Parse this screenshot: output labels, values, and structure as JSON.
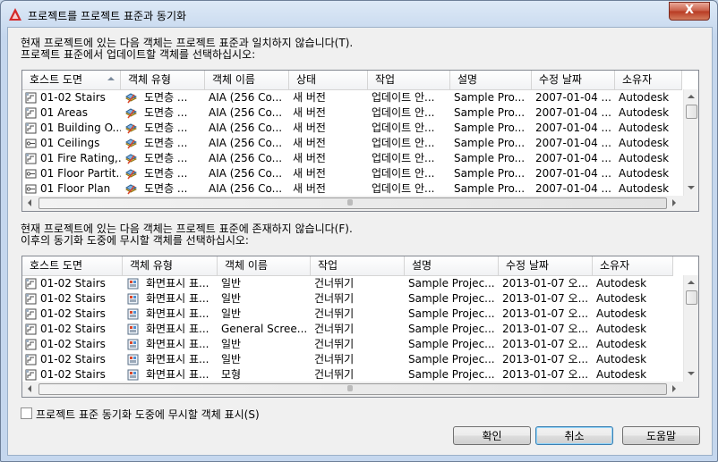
{
  "window": {
    "title": "프로젝트를 프로젝트 표준과 동기화",
    "close_glyph": "X"
  },
  "section1": {
    "prompt_line1": "현재 프로젝트에 있는 다음 객체는 프로젝트 표준과 일치하지 않습니다(T).",
    "prompt_line2": "프로젝트 표준에서 업데이트할 객체를 선택하십시오:",
    "columns": [
      "호스트 도면",
      "객체 유형",
      "객체 이름",
      "상태",
      "작업",
      "설명",
      "수정 날짜",
      "소유자"
    ],
    "rows": [
      [
        "01-02 Stairs",
        "도면층 ...",
        "AIA (256 Co...",
        "새 버전",
        "업데이트 안...",
        "Sample Pro...",
        "2007-01-04 ...",
        "Autodesk"
      ],
      [
        "01 Areas",
        "도면층 ...",
        "AIA (256 Co...",
        "새 버전",
        "업데이트 안...",
        "Sample Pro...",
        "2007-01-04 ...",
        "Autodesk"
      ],
      [
        "01 Building O...",
        "도면층 ...",
        "AIA (256 Co...",
        "새 버전",
        "업데이트 안...",
        "Sample Pro...",
        "2007-01-04 ...",
        "Autodesk"
      ],
      [
        "01 Ceilings",
        "도면층 ...",
        "AIA (256 Co...",
        "새 버전",
        "업데이트 안...",
        "Sample Pro...",
        "2007-01-04 ...",
        "Autodesk"
      ],
      [
        "01 Fire Rating,...",
        "도면층 ...",
        "AIA (256 Co...",
        "새 버전",
        "업데이트 안...",
        "Sample Pro...",
        "2007-01-04 ...",
        "Autodesk"
      ],
      [
        "01 Floor Partit...",
        "도면층 ...",
        "AIA (256 Co...",
        "새 버전",
        "업데이트 안...",
        "Sample Pro...",
        "2007-01-04 ...",
        "Autodesk"
      ],
      [
        "01 Floor Plan",
        "도면층 ...",
        "AIA (256 Co...",
        "새 버전",
        "업데이트 안...",
        "Sample Pro...",
        "2007-01-04 ...",
        "Autodesk"
      ]
    ],
    "row_icons": [
      "stair-drawing",
      "stair-drawing",
      "stair-drawing",
      "plan-drawing",
      "stair-drawing",
      "plan-drawing",
      "plan-drawing"
    ]
  },
  "section2": {
    "prompt_line1": "현재 프로젝트에 있는 다음 객체는 프로젝트 표준에 존재하지 않습니다(F).",
    "prompt_line2": "이후의 동기화 도중에 무시할 객체를 선택하십시오:",
    "columns": [
      "호스트 도면",
      "객체 유형",
      "객체 이름",
      "작업",
      "설명",
      "수정 날짜",
      "소유자"
    ],
    "rows": [
      [
        "01-02 Stairs",
        "화면표시 표...",
        "일반",
        "건너뛰기",
        "Sample Projec...",
        "2013-01-07 오...",
        "Autodesk"
      ],
      [
        "01-02 Stairs",
        "화면표시 표...",
        "일반",
        "건너뛰기",
        "Sample Projec...",
        "2013-01-07 오...",
        "Autodesk"
      ],
      [
        "01-02 Stairs",
        "화면표시 표...",
        "일반",
        "건너뛰기",
        "Sample Projec...",
        "2013-01-07 오...",
        "Autodesk"
      ],
      [
        "01-02 Stairs",
        "화면표시 표...",
        "General Scree...",
        "건너뛰기",
        "Sample Projec...",
        "2013-01-07 오...",
        "Autodesk"
      ],
      [
        "01-02 Stairs",
        "화면표시 표...",
        "일반",
        "건너뛰기",
        "Sample Projec...",
        "2013-01-07 오...",
        "Autodesk"
      ],
      [
        "01-02 Stairs",
        "화면표시 표...",
        "일반",
        "건너뛰기",
        "Sample Projec...",
        "2013-01-07 오...",
        "Autodesk"
      ],
      [
        "01-02 Stairs",
        "화면표시 표...",
        "모형",
        "건너뛰기",
        "Sample Projec...",
        "2013-01-07 오...",
        "Autodesk"
      ]
    ]
  },
  "checkbox": {
    "label": "프로젝트 표준 동기화 도중에 무시할 객체 표시(S)",
    "checked": false
  },
  "buttons": {
    "ok": "확인",
    "cancel": "취소",
    "help": "도움말"
  },
  "colors": {
    "accent": "#3c7fb1",
    "close": "#c75b44",
    "app_icon": "#d42a2a"
  }
}
